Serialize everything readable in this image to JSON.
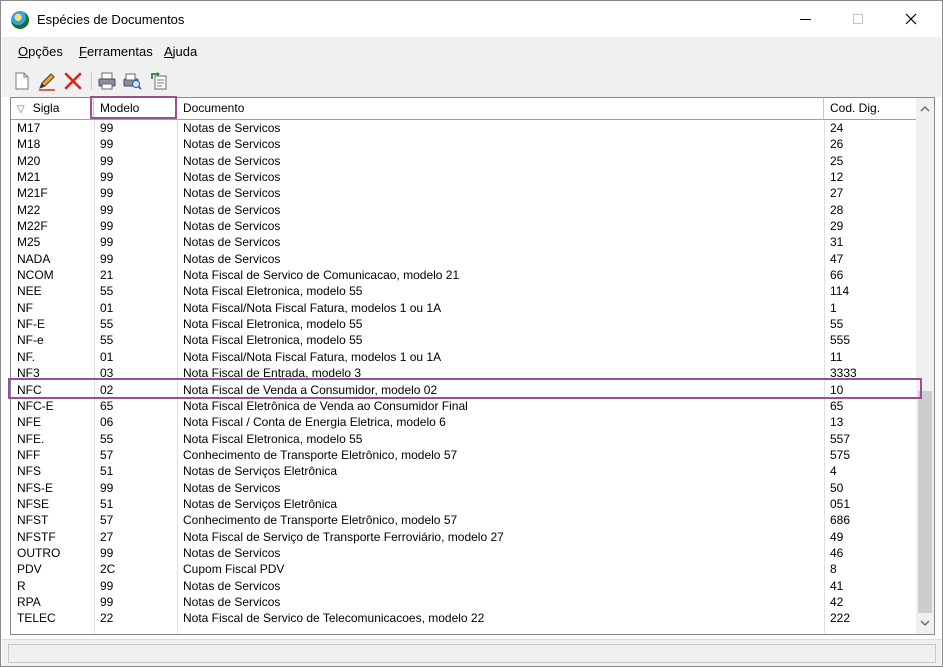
{
  "window": {
    "title": "Espécies de Documentos"
  },
  "menu": [
    {
      "label": "Opções",
      "accel": "O",
      "rest": "pções"
    },
    {
      "label": "Ferramentas",
      "accel": "F",
      "rest": "erramentas"
    },
    {
      "label": "Ajuda",
      "accel": "A",
      "rest": "juda"
    }
  ],
  "toolbar": {
    "icons": [
      "new-document-icon",
      "edit-pencil-icon",
      "delete-x-icon",
      "print-icon",
      "print-preview-icon",
      "export-icon"
    ]
  },
  "grid": {
    "columns": [
      "Sigla",
      "Modelo",
      "Documento",
      "Cod. Dig."
    ],
    "sort_indicator": "▽",
    "rows": [
      [
        "M17",
        "99",
        "Notas de Servicos",
        "24"
      ],
      [
        "M18",
        "99",
        "Notas de Servicos",
        "26"
      ],
      [
        "M20",
        "99",
        "Notas de Servicos",
        "25"
      ],
      [
        "M21",
        "99",
        "Notas de Servicos",
        "12"
      ],
      [
        "M21F",
        "99",
        "Notas de Servicos",
        "27"
      ],
      [
        "M22",
        "99",
        "Notas de Servicos",
        "28"
      ],
      [
        "M22F",
        "99",
        "Notas de Servicos",
        "29"
      ],
      [
        "M25",
        "99",
        "Notas de Servicos",
        "31"
      ],
      [
        "NADA",
        "99",
        "Notas de Servicos",
        "47"
      ],
      [
        "NCOM",
        "21",
        "Nota Fiscal de Servico de Comunicacao, modelo 21",
        "66"
      ],
      [
        "NEE",
        "55",
        "Nota Fiscal Eletronica, modelo 55",
        "114"
      ],
      [
        "NF",
        "01",
        "Nota Fiscal/Nota Fiscal Fatura, modelos 1 ou 1A",
        "1"
      ],
      [
        "NF-E",
        "55",
        "Nota Fiscal Eletronica, modelo 55",
        "55"
      ],
      [
        "NF-e",
        "55",
        "Nota Fiscal Eletronica, modelo 55",
        "555"
      ],
      [
        "NF.",
        "01",
        "Nota Fiscal/Nota Fiscal Fatura, modelos 1 ou 1A",
        "11"
      ],
      [
        "NF3",
        "03",
        "Nota Fiscal de Entrada, modelo 3",
        "3333"
      ],
      [
        "NFC",
        "02",
        "Nota Fiscal de Venda a Consumidor, modelo 02",
        "10"
      ],
      [
        "NFC-E",
        "65",
        "Nota Fiscal Eletrônica de Venda ao Consumidor Final",
        "65"
      ],
      [
        "NFE",
        "06",
        "Nota Fiscal / Conta de Energia Eletrica, modelo 6",
        "13"
      ],
      [
        "NFE.",
        "55",
        "Nota Fiscal Eletronica, modelo 55",
        "557"
      ],
      [
        "NFF",
        "57",
        "Conhecimento de Transporte Eletrônico, modelo 57",
        "575"
      ],
      [
        "NFS",
        "51",
        "Notas de Serviços Eletrônica",
        "4"
      ],
      [
        "NFS-E",
        "99",
        "Notas de Servicos",
        "50"
      ],
      [
        "NFSE",
        "51",
        "Notas de Serviços Eletrônica",
        "051"
      ],
      [
        "NFST",
        "57",
        "Conhecimento de Transporte Eletrônico, modelo 57",
        "686"
      ],
      [
        "NFSTF",
        "27",
        "Nota Fiscal de Serviço de Transporte Ferroviário, modelo 27",
        "49"
      ],
      [
        "OUTRO",
        "99",
        "Notas de Servicos",
        "46"
      ],
      [
        "PDV",
        "2C",
        "Cupom Fiscal PDV",
        "8"
      ],
      [
        "R",
        "99",
        "Notas de Servicos",
        "41"
      ],
      [
        "RPA",
        "99",
        "Notas de Servicos",
        "42"
      ],
      [
        "TELEC",
        "22",
        "Nota Fiscal de Servico de Telecomunicacoes, modelo 22",
        "222"
      ]
    ]
  },
  "colors": {
    "highlight": "#9b4c9b",
    "menu_bg": "#f0f0f0",
    "grid_border": "#828790"
  }
}
